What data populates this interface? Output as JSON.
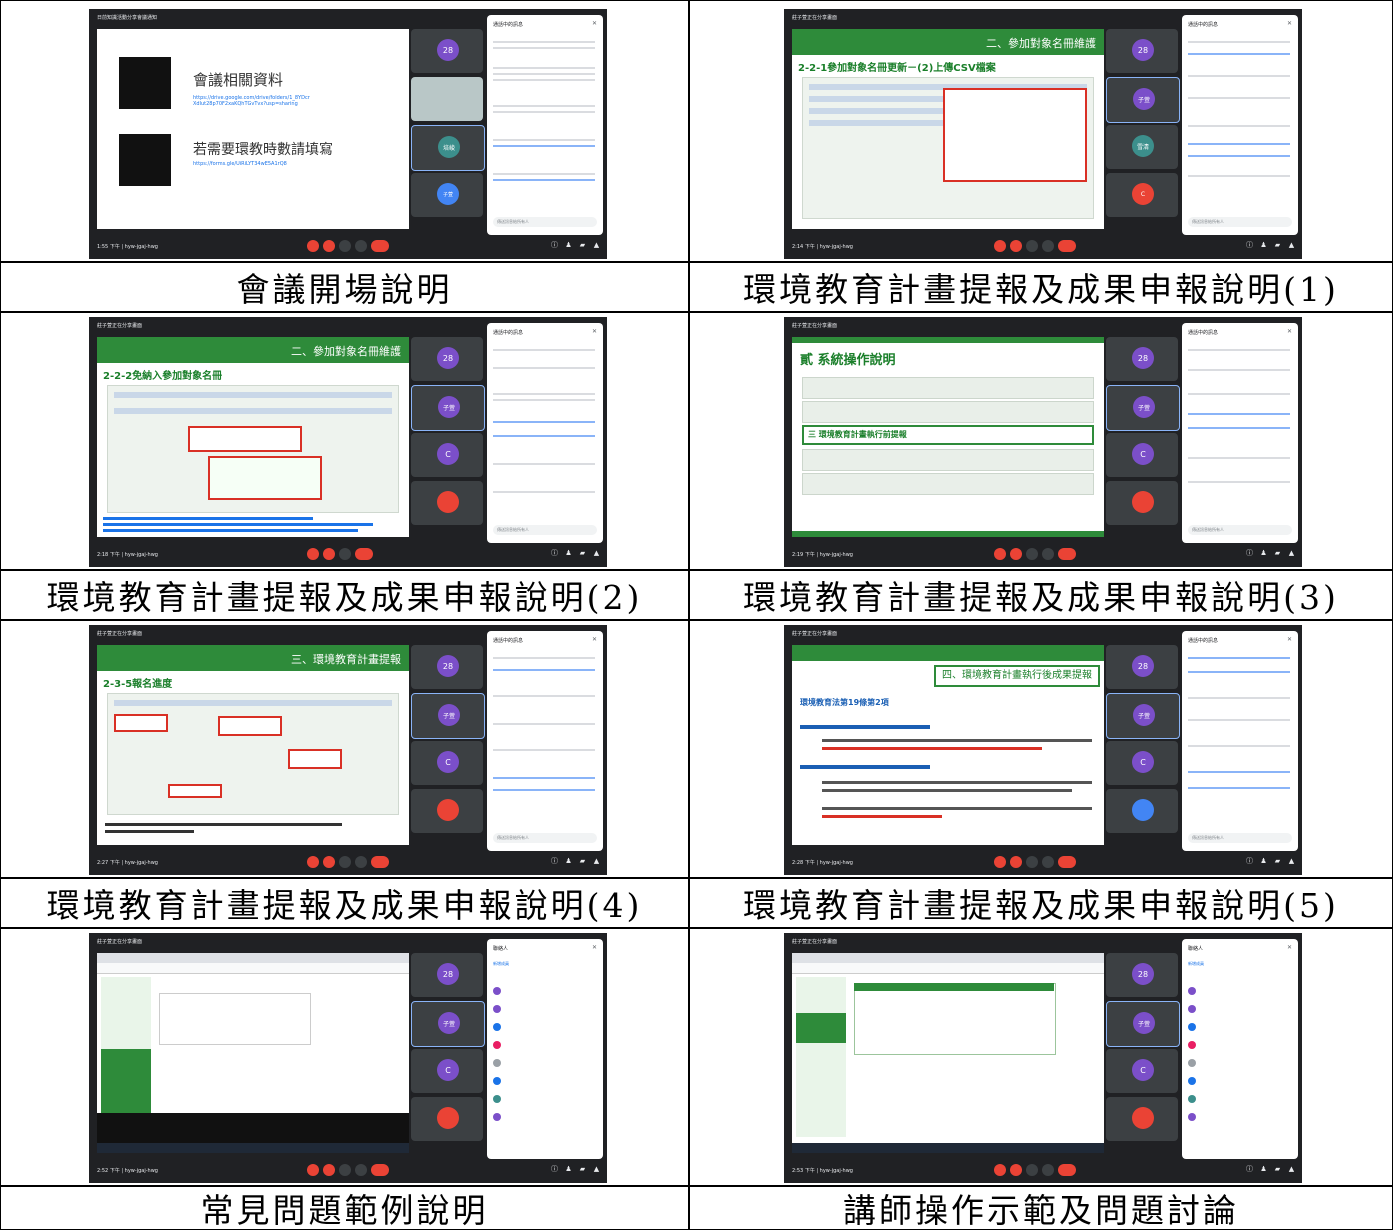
{
  "captions": [
    "會議開場說明",
    "環境教育計畫提報及成果申報說明(1)",
    "環境教育計畫提報及成果申報說明(2)",
    "環境教育計畫提報及成果申報說明(3)",
    "環境教育計畫提報及成果申報說明(4)",
    "環境教育計畫提報及成果申報說明(5)",
    "常見問題範例說明",
    "講師操作示範及問題討論"
  ],
  "shots": [
    {
      "window_title": "日前知識活動分享會議通知",
      "slide_kind": "intro",
      "slide_title": "會議相關資料",
      "slide_link1": "https://drive.google.com/drive/folders/1_8YDcrXdlut28p70F2xaKQhTGvTvx?usp=sharing",
      "slide_text2": "若需要環教時數請填寫",
      "slide_link2": "https://forms.gle/UiRiLYT34wE5A1rQ8",
      "participant_count": "28",
      "tile_names": [
        "培峻",
        "子萱"
      ],
      "chat_title": "通話中的訊息",
      "chat_placeholder": "傳送訊息給所有人",
      "time": "1:55 下午 | hyw-jgaj-hwg"
    },
    {
      "window_title": "莊子萱正在分享畫面",
      "slide_kind": "band",
      "slide_band_title": "二、參加對象名冊維護",
      "slide_sub": "2-2-1參加對象名冊更新－(2)上傳CSV檔案",
      "participant_count": "28",
      "tile_names": [
        "子萱",
        "雪清"
      ],
      "chat_title": "通話中的訊息",
      "chat_placeholder": "傳送訊息給所有人",
      "time": "2:14 下午 | hyw-jgaj-hwg"
    },
    {
      "window_title": "莊子萱正在分享畫面",
      "slide_kind": "band",
      "slide_band_title": "二、參加對象名冊維護",
      "slide_sub": "2-2-2免納入參加對象名冊",
      "participant_count": "28",
      "tile_names": [
        "子萱",
        "C"
      ],
      "chat_title": "通話中的訊息",
      "chat_placeholder": "傳送訊息給所有人",
      "time": "2:18 下午 | hyw-jgaj-hwg"
    },
    {
      "window_title": "莊子萱正在分享畫面",
      "slide_kind": "band",
      "slide_band_title": "貳 系統操作說明",
      "slide_sub": "三 環境教育計畫執行前提報",
      "participant_count": "28",
      "tile_names": [
        "子萱",
        "C"
      ],
      "chat_title": "通話中的訊息",
      "chat_placeholder": "傳送訊息給所有人",
      "time": "2:19 下午 | hyw-jgaj-hwg"
    },
    {
      "window_title": "莊子萱正在分享畫面",
      "slide_kind": "band",
      "slide_band_title": "三、環境教育計畫提報",
      "slide_sub": "2-3-5報名進度",
      "participant_count": "28",
      "tile_names": [
        "子萱",
        "C"
      ],
      "chat_title": "通話中的訊息",
      "chat_placeholder": "傳送訊息給所有人",
      "time": "2:27 下午 | hyw-jgaj-hwg"
    },
    {
      "window_title": "莊子萱正在分享畫面",
      "slide_kind": "band",
      "slide_band_title": "四、環境教育計畫執行後成果提報",
      "slide_sub": "環境教育法第19條第2項",
      "participant_count": "28",
      "tile_names": [
        "子萱",
        "C"
      ],
      "chat_title": "通話中的訊息",
      "chat_placeholder": "傳送訊息給所有人",
      "time": "2:28 下午 | hyw-jgaj-hwg"
    },
    {
      "window_title": "莊子萱正在分享畫面",
      "slide_kind": "browser",
      "participant_count": "28",
      "tile_names": [
        "子萱",
        "C"
      ],
      "chat_title": "聯絡人",
      "chat_placeholder": "新增成員",
      "time": "2:52 下午 | hyw-jgaj-hwg"
    },
    {
      "window_title": "莊子萱正在分享畫面",
      "slide_kind": "browser",
      "participant_count": "28",
      "tile_names": [
        "子萱",
        "C"
      ],
      "chat_title": "聯絡人",
      "chat_placeholder": "新增成員",
      "time": "2:53 下午 | hyw-jgaj-hwg"
    }
  ],
  "colors": {
    "meet_bg": "#202124",
    "slide_green": "#2e8b3a",
    "accent_red": "#ea4335",
    "avatar_purple": "#7b4fc9",
    "avatar_blue": "#4285f4"
  }
}
